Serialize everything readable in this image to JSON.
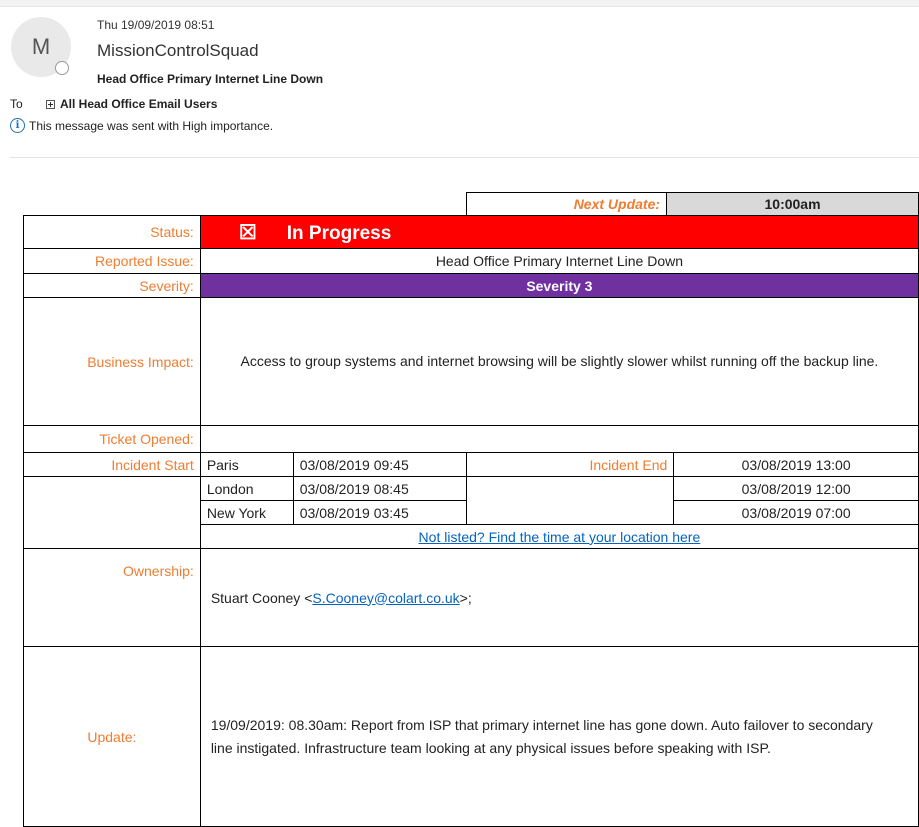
{
  "email": {
    "avatar_initial": "M",
    "date": "Thu 19/09/2019 08:51",
    "sender": "MissionControlSquad",
    "subject": "Head Office Primary Internet Line Down",
    "to_label": "To",
    "recipient": "All Head Office Email Users",
    "importance_notice": "This message was sent with High importance."
  },
  "next_update": {
    "label": "Next Update:",
    "value": "10:00am"
  },
  "status": {
    "label": "Status:",
    "checkbox": "☒",
    "value": "In Progress"
  },
  "reported_issue": {
    "label": "Reported Issue:",
    "value": "Head Office Primary Internet Line Down"
  },
  "severity": {
    "label": "Severity:",
    "value": "Severity 3"
  },
  "business_impact": {
    "label": "Business Impact:",
    "value": "Access to group systems and internet browsing will be slightly slower whilst running off the backup line."
  },
  "ticket_opened": {
    "label": "Ticket Opened:",
    "value": ""
  },
  "incident": {
    "start_label": "Incident Start",
    "end_label": "Incident End",
    "rows": [
      {
        "city": "Paris",
        "start": "03/08/2019 09:45",
        "end": "03/08/2019 13:00"
      },
      {
        "city": "London",
        "start": "03/08/2019 08:45",
        "end": "03/08/2019 12:00"
      },
      {
        "city": "New York",
        "start": "03/08/2019 03:45",
        "end": "03/08/2019 07:00"
      }
    ],
    "location_link": "Not listed? Find the time at your location here"
  },
  "ownership": {
    "label": "Ownership:",
    "name": "Stuart Cooney <",
    "email": "S.Cooney@colart.co.uk",
    "suffix": ">;"
  },
  "update": {
    "label": "Update:",
    "value": "19/09/2019: 08.30am: Report from ISP that primary internet line has gone down. Auto failover to secondary line instigated. Infrastructure team looking at any physical issues before speaking with ISP."
  },
  "colors": {
    "status_red": "#ff0000",
    "severity_purple": "#7030a0",
    "label_orange": "#ed7d31",
    "link_blue": "#0563c1"
  }
}
